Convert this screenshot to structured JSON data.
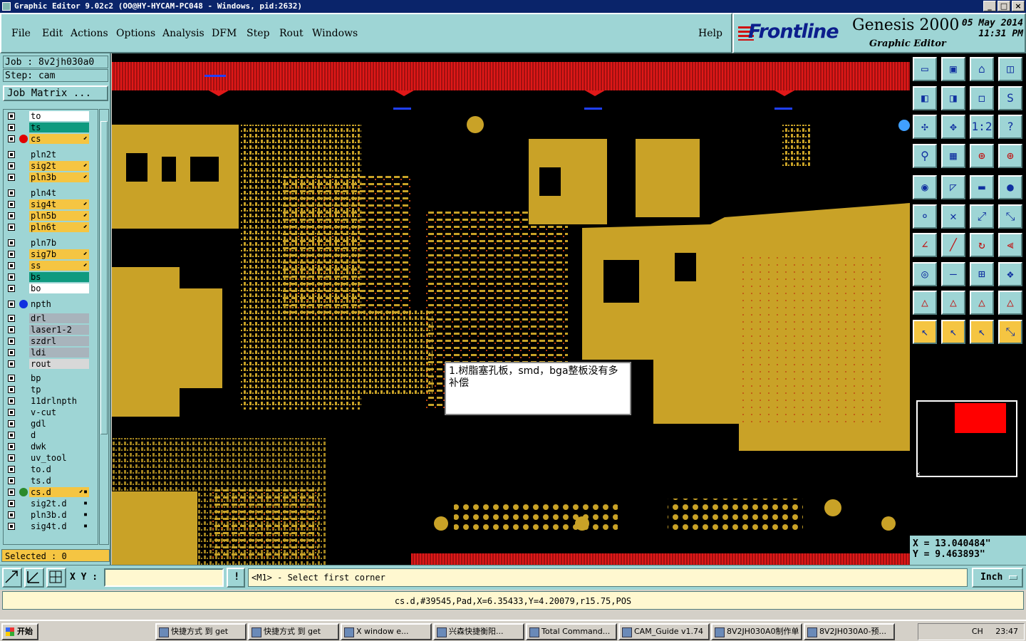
{
  "window": {
    "title": "Graphic Editor 9.02c2 (OO@HY-HYCAM-PC048 - Windows, pid:2632)"
  },
  "menu": [
    "File",
    "Edit",
    "Actions",
    "Options",
    "Analysis",
    "DFM",
    "Step",
    "Rout",
    "Windows"
  ],
  "help": "Help",
  "brand": {
    "logo": "Frontline",
    "product": "Genesis 2000",
    "subtitle": "Graphic Editor",
    "date": "05 May 2014",
    "time": "11:31 PM"
  },
  "job": {
    "job_line": "Job : 8v2jh030a0",
    "step_line": "Step: cam",
    "matrix_button": "Job Matrix ..."
  },
  "layers": [
    {
      "name": "to",
      "color": "#ffffff",
      "dot": ""
    },
    {
      "name": "ts",
      "color": "#0f9a7f",
      "dot": ""
    },
    {
      "name": "cs",
      "color": "#f5c542",
      "dot": "#e00000",
      "mark": "⬋"
    },
    {
      "name": "pln2t",
      "color": "#9ed5d5",
      "dot": ""
    },
    {
      "name": "sig2t",
      "color": "#f5c542",
      "dot": "",
      "mark": "⬋"
    },
    {
      "name": "pln3b",
      "color": "#f5c542",
      "dot": "",
      "mark": "⬋"
    },
    {
      "name": "pln4t",
      "color": "#9ed5d5",
      "dot": ""
    },
    {
      "name": "sig4t",
      "color": "#f5c542",
      "dot": "",
      "mark": "⬋"
    },
    {
      "name": "pln5b",
      "color": "#f5c542",
      "dot": "",
      "mark": "⬋"
    },
    {
      "name": "pln6t",
      "color": "#f5c542",
      "dot": "",
      "mark": "⬋"
    },
    {
      "name": "pln7b",
      "color": "#9ed5d5",
      "dot": ""
    },
    {
      "name": "sig7b",
      "color": "#f5c542",
      "dot": "",
      "mark": "⬋"
    },
    {
      "name": "ss",
      "color": "#f5c542",
      "dot": "",
      "mark": "⬋"
    },
    {
      "name": "bs",
      "color": "#0f9a7f",
      "dot": ""
    },
    {
      "name": "bo",
      "color": "#ffffff",
      "dot": ""
    },
    {
      "name": "npth",
      "color": "#9ed5d5",
      "dot": "#1030e0"
    },
    {
      "name": "drl",
      "color": "#a8b4bc",
      "dot": ""
    },
    {
      "name": "laser1-2",
      "color": "#a8b4bc",
      "dot": ""
    },
    {
      "name": "szdrl",
      "color": "#a8b4bc",
      "dot": ""
    },
    {
      "name": "ldi",
      "color": "#a8b4bc",
      "dot": ""
    },
    {
      "name": "rout",
      "color": "#d8d8d8",
      "dot": ""
    },
    {
      "name": "bp",
      "color": "#9ed5d5",
      "dot": ""
    },
    {
      "name": "tp",
      "color": "#9ed5d5",
      "dot": ""
    },
    {
      "name": "11drlnpth",
      "color": "#9ed5d5",
      "dot": ""
    },
    {
      "name": "v-cut",
      "color": "#9ed5d5",
      "dot": ""
    },
    {
      "name": "gdl",
      "color": "#9ed5d5",
      "dot": ""
    },
    {
      "name": "d",
      "color": "#9ed5d5",
      "dot": ""
    },
    {
      "name": "dwk",
      "color": "#9ed5d5",
      "dot": ""
    },
    {
      "name": "uv_tool",
      "color": "#9ed5d5",
      "dot": ""
    },
    {
      "name": "to.d",
      "color": "#9ed5d5",
      "dot": ""
    },
    {
      "name": "ts.d",
      "color": "#9ed5d5",
      "dot": ""
    },
    {
      "name": "cs.d",
      "color": "#f5c542",
      "dot": "#2a8a2a",
      "mark": "⬋▪"
    },
    {
      "name": "sig2t.d",
      "color": "#9ed5d5",
      "dot": "",
      "mark": "▪"
    },
    {
      "name": "pln3b.d",
      "color": "#9ed5d5",
      "dot": "",
      "mark": "▪"
    },
    {
      "name": "sig4t.d",
      "color": "#9ed5d5",
      "dot": "",
      "mark": "▪"
    }
  ],
  "selected": "Selected : 0",
  "canvas": {
    "note": "1.树脂塞孔板，smd，bga整板没有多补偿"
  },
  "coords": {
    "x": "X = 13.040484\"",
    "y": "Y = 9.463893\""
  },
  "cmd": {
    "xy_label": "X Y :",
    "xy_value": "",
    "prompt": "<M1> - Select first corner",
    "unit": "Inch"
  },
  "status": "cs.d,#39545,Pad,X=6.35433,Y=4.20079,r15.75,POS",
  "taskbar": {
    "start": "开始",
    "items": [
      "快捷方式 到 get",
      "快捷方式 到 get",
      "X window e...",
      "兴森快捷衡阳...",
      "Total Command...",
      "CAM_Guide v1.74",
      "8V2JH030A0制作单",
      "8V2JH030A0-预..."
    ],
    "lang": "CH",
    "clock": "23:47"
  },
  "colors": {
    "copper": "#c9a227",
    "frame": "#e01818",
    "bg": "#000000",
    "panel": "#9ed5d5"
  }
}
